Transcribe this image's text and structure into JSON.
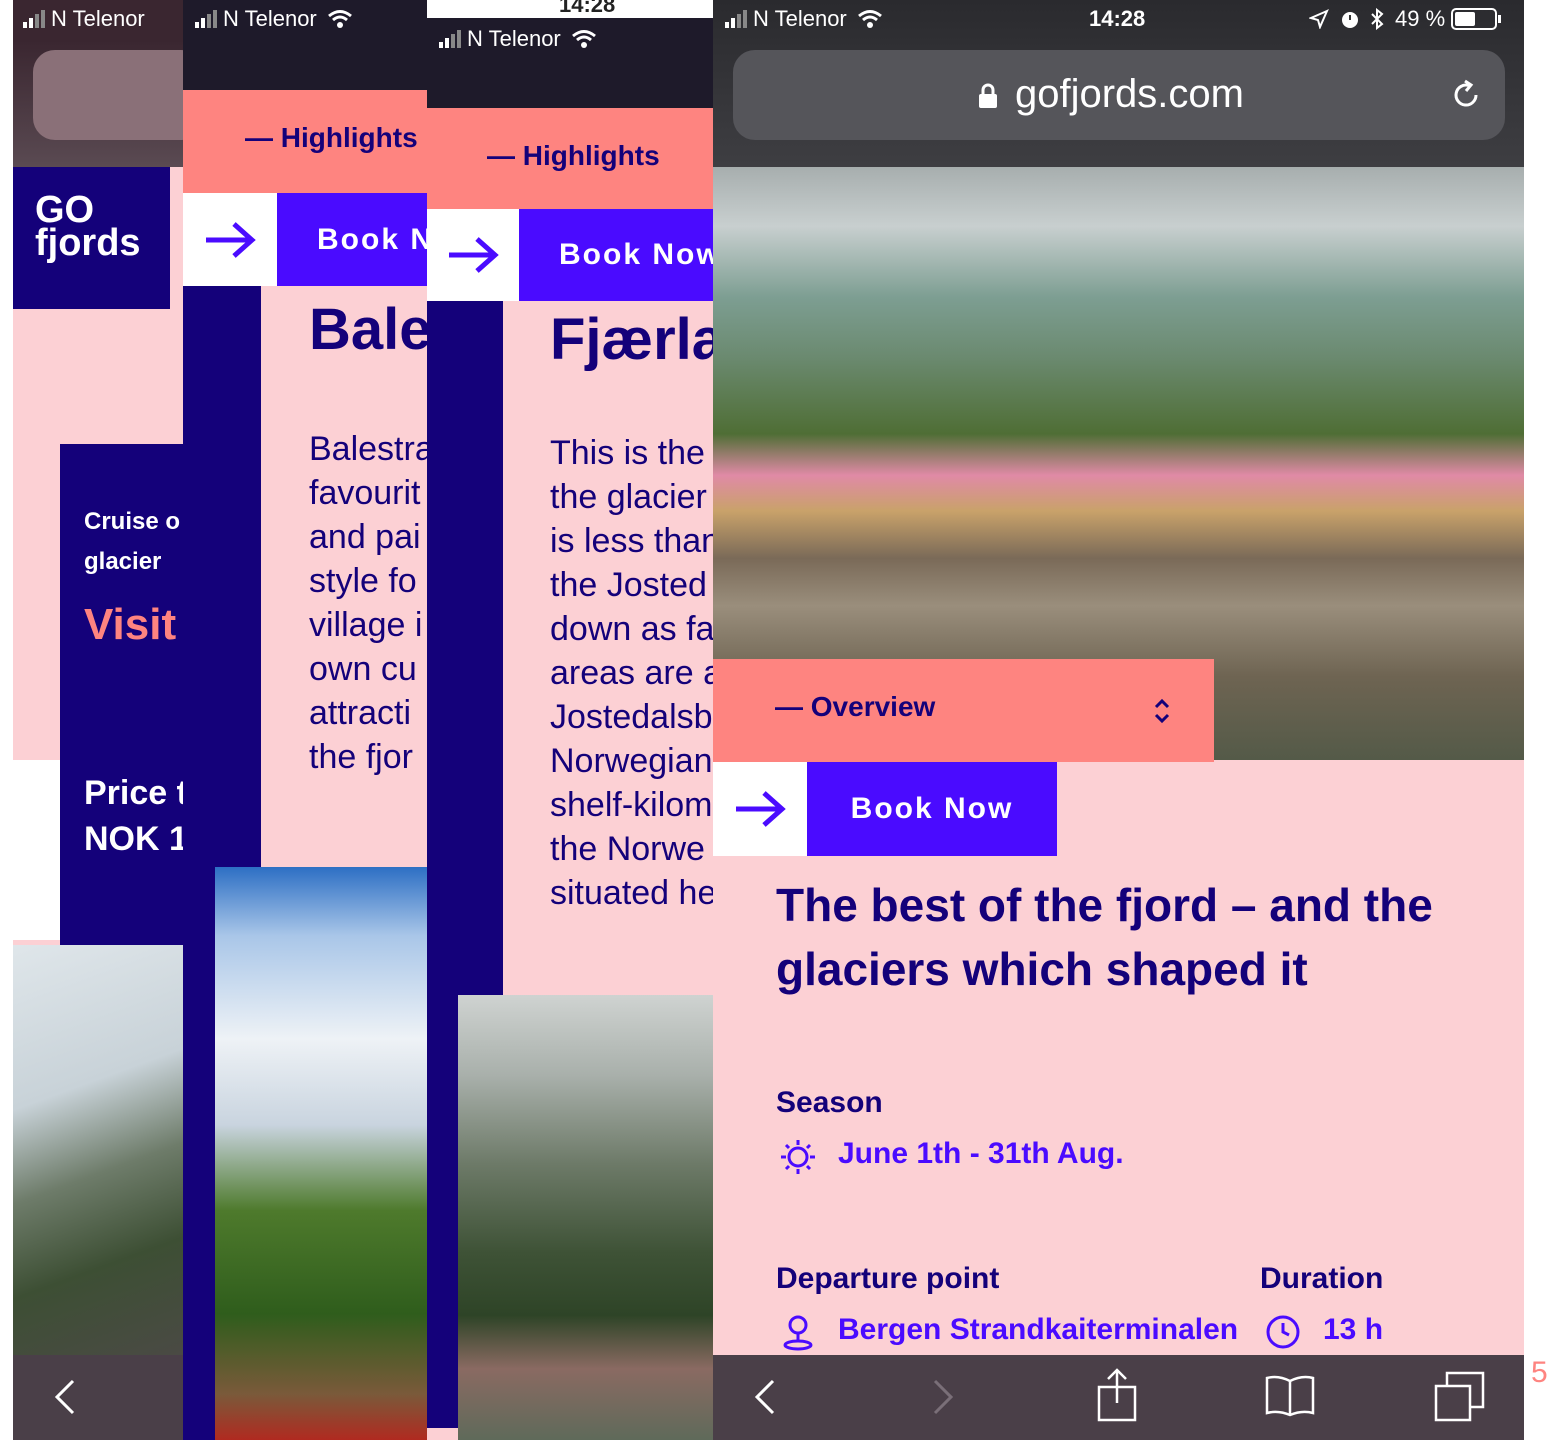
{
  "status": {
    "carrier": "N Telenor",
    "time": "14:28",
    "time_partial": "14:28",
    "battery_percent": "49 %"
  },
  "screen1": {
    "logo_top": "GO",
    "logo_bottom": "fjords",
    "cruise_line1": "Cruise o",
    "cruise_line2": "glacier",
    "visit": "Visit",
    "price_line1": "Price t",
    "price_line2": "NOK 1"
  },
  "screen2": {
    "highlights": "— Highlights",
    "book": "Book N",
    "title": "Bale",
    "paragraph": "Balestra\nfavourit\nand pai\nstyle fo\nvillage i\nown cu\nattracti\nthe fjor"
  },
  "screen3": {
    "highlights": "— Highlights",
    "book": "Book Now",
    "title": "Fjærla",
    "paragraph": "This is the v\nthe glacier\nis less than\nthe Josted\ndown as fa\nareas are a\nJostedalsb\nNorwegian\nshelf-kilom\nthe Norwe\nsituated he"
  },
  "screen4": {
    "url": "gofjords.com",
    "overview": "— Overview",
    "book": "Book Now",
    "heading_line1": "The best of the fjord – and the",
    "heading_line2": "glaciers which shaped it",
    "season_label": "Season",
    "season_value": "June 1th - 31th Aug.",
    "departure_label": "Departure point",
    "departure_value": "Bergen Strandkaiterminalen",
    "duration_label": "Duration",
    "duration_value": "13 h"
  },
  "page_number": "5",
  "icons": [
    "lock-icon",
    "reload-icon",
    "arrow-right-icon",
    "chevron-updown-icon",
    "sun-icon",
    "location-pin-icon",
    "clock-icon",
    "back-icon",
    "forward-icon",
    "share-icon",
    "bookmarks-icon",
    "tabs-icon",
    "wifi-icon",
    "signal-icon",
    "battery-icon",
    "alarm-icon",
    "bluetooth-icon",
    "location-arrow-icon"
  ],
  "colors": {
    "pink": "#fcd0d4",
    "navy": "#14017a",
    "coral": "#fe8480",
    "violet": "#4a0bff"
  }
}
